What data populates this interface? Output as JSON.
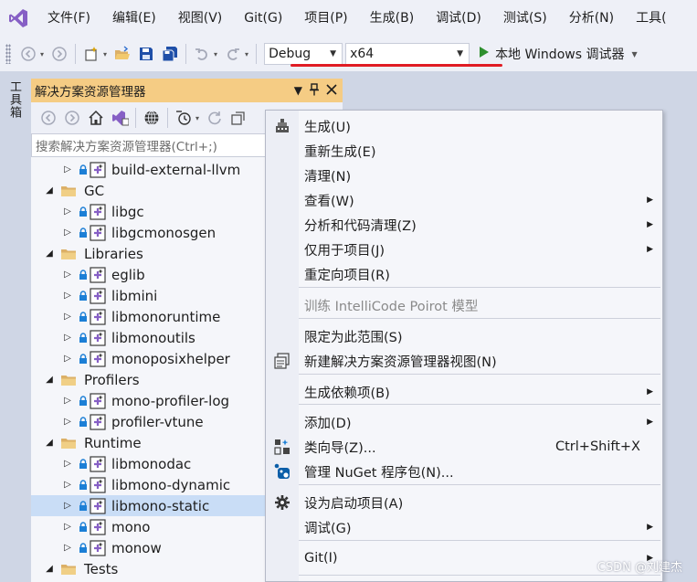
{
  "menubar": {
    "items": [
      "文件(F)",
      "编辑(E)",
      "视图(V)",
      "Git(G)",
      "项目(P)",
      "生成(B)",
      "调试(D)",
      "测试(S)",
      "分析(N)",
      "工具("
    ]
  },
  "toolbar": {
    "configuration": "Debug",
    "platform": "x64",
    "debugger_label": "本地 Windows 调试器"
  },
  "toolbox": {
    "label": "工具箱"
  },
  "solution_explorer": {
    "title": "解决方案资源管理器",
    "search_placeholder": "搜索解决方案资源管理器(Ctrl+;)",
    "tree": [
      {
        "label": "build-external-llvm",
        "kind": "project",
        "expanded": false
      },
      {
        "label": "GC",
        "kind": "folder",
        "expanded": true
      },
      {
        "label": "libgc",
        "kind": "project",
        "expanded": false
      },
      {
        "label": "libgcmonosgen",
        "kind": "project",
        "expanded": false
      },
      {
        "label": "Libraries",
        "kind": "folder",
        "expanded": true
      },
      {
        "label": "eglib",
        "kind": "project",
        "expanded": false
      },
      {
        "label": "libmini",
        "kind": "project",
        "expanded": false
      },
      {
        "label": "libmonoruntime",
        "kind": "project",
        "expanded": false
      },
      {
        "label": "libmonoutils",
        "kind": "project",
        "expanded": false
      },
      {
        "label": "monoposixhelper",
        "kind": "project",
        "expanded": false
      },
      {
        "label": "Profilers",
        "kind": "folder",
        "expanded": true
      },
      {
        "label": "mono-profiler-log",
        "kind": "project",
        "expanded": false
      },
      {
        "label": "profiler-vtune",
        "kind": "project",
        "expanded": false
      },
      {
        "label": "Runtime",
        "kind": "folder",
        "expanded": true
      },
      {
        "label": "libmonodac",
        "kind": "project",
        "expanded": false
      },
      {
        "label": "libmono-dynamic",
        "kind": "project",
        "expanded": false
      },
      {
        "label": "libmono-static",
        "kind": "project",
        "expanded": false,
        "selected": true
      },
      {
        "label": "mono",
        "kind": "project",
        "expanded": false
      },
      {
        "label": "monow",
        "kind": "project",
        "expanded": false
      },
      {
        "label": "Tests",
        "kind": "folder",
        "expanded": true
      }
    ]
  },
  "context_menu": {
    "items": [
      {
        "label": "生成(U)",
        "icon": "build-icon"
      },
      {
        "label": "重新生成(E)"
      },
      {
        "label": "清理(N)"
      },
      {
        "label": "查看(W)",
        "submenu": true
      },
      {
        "label": "分析和代码清理(Z)",
        "submenu": true
      },
      {
        "label": "仅用于项目(J)",
        "submenu": true
      },
      {
        "label": "重定向项目(R)"
      },
      {
        "label": "训练 IntelliCode Poirot 模型",
        "disabled": true
      },
      {
        "label": "限定为此范围(S)"
      },
      {
        "label": "新建解决方案资源管理器视图(N)",
        "icon": "new-view-icon"
      },
      {
        "label": "生成依赖项(B)",
        "submenu": true
      },
      {
        "label": "添加(D)",
        "submenu": true
      },
      {
        "label": "类向导(Z)...",
        "icon": "class-wizard-icon",
        "shortcut": "Ctrl+Shift+X"
      },
      {
        "label": "管理 NuGet 程序包(N)...",
        "icon": "nuget-icon"
      },
      {
        "label": "设为启动项目(A)",
        "icon": "gear-icon"
      },
      {
        "label": "调试(G)",
        "submenu": true
      },
      {
        "label": "Git(I)",
        "submenu": true
      }
    ]
  },
  "watermark": "CSDN @刘建杰",
  "colors": {
    "accent_title": "#f5cc84",
    "selection": "#c9ddf6",
    "underline": "#e01c24",
    "vs_purple": "#865fc5",
    "play_green": "#2e8f2e"
  }
}
